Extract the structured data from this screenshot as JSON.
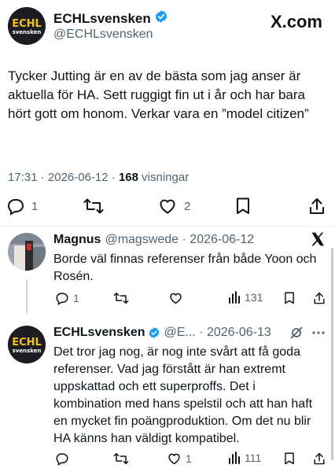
{
  "header": {
    "name": "ECHLsvensken",
    "handle": "@ECHLsvensken",
    "site": "X.com",
    "avatar_text_top": "ECHL",
    "avatar_text_bottom": "svensken"
  },
  "tweet": {
    "text": "Tycker Jutting är en av de bästa som jag anser är aktuella för HA. Sett ruggigt fin ut i år och har bara hört gott om honom. Verkar vara en ”model citizen”",
    "time": "17:31",
    "date": "2026-06-12",
    "views": "168",
    "views_label": "visningar",
    "sep": "·"
  },
  "main_actions": {
    "reply_count": "1",
    "retweet_count": "",
    "like_count": "2"
  },
  "replies": [
    {
      "name": "Magnus",
      "sub": "@magswede · 2026-06-12",
      "text": "Borde väl finnas referenser från både Yoon och Rosén.",
      "reply_count": "1",
      "retweet_count": "",
      "like_count": "",
      "views": "131"
    },
    {
      "name": "ECHLsvensken",
      "sub": "@E... · 2026-06-13",
      "text": "Det tror jag nog, är nog inte svårt att få goda referenser. Vad jag förstått är han extremt uppskattad och ett superproffs. Det i kombination med hans spelstil och att han haft en mycket fin poängproduktion. Om det nu blir HA känns han väldigt kompatibel.",
      "reply_count": "",
      "retweet_count": "",
      "like_count": "1",
      "views": "111"
    }
  ],
  "colors": {
    "verified": "#1d9bf0",
    "muted": "#536471",
    "text": "#0f1419"
  },
  "icons": [
    "verified-badge-icon",
    "reply-icon",
    "retweet-icon",
    "like-icon",
    "bookmark-icon",
    "share-icon",
    "views-icon",
    "more-icon",
    "grok-icon",
    "x-logo-icon"
  ]
}
